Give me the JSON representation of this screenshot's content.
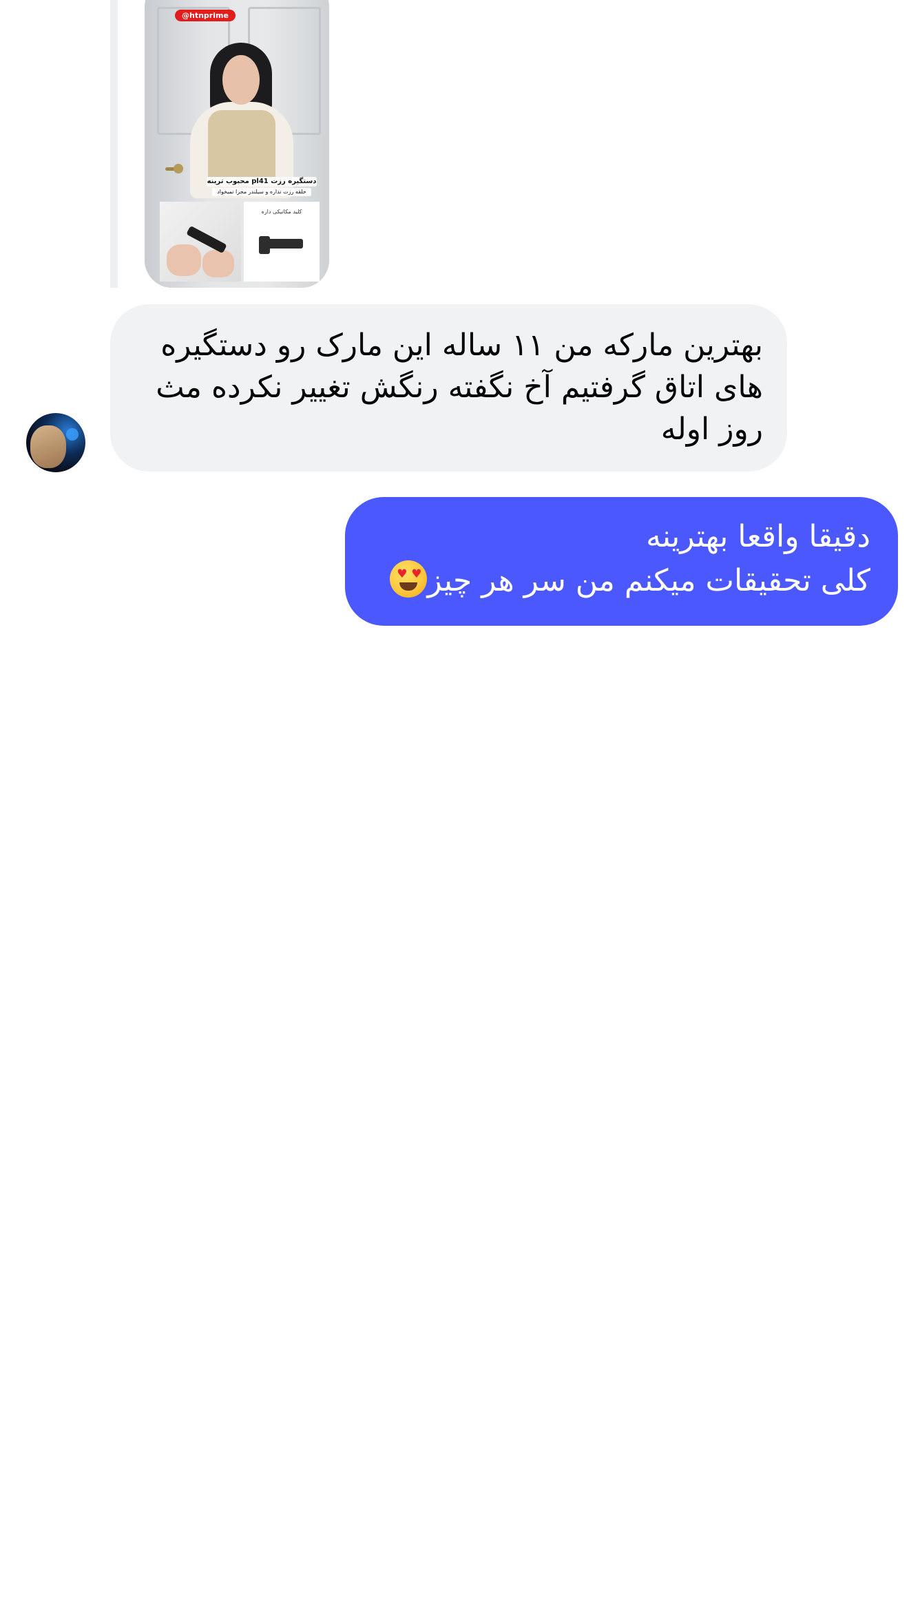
{
  "thread": {
    "shared_post": {
      "watermark": "@htnprime",
      "caption": "دستگیره رزت pl41 محبوب ترینه",
      "caption_sub": "حلقه رزت نداره و سیلندر مجزا نمیخواد",
      "inset_label": "کلید مکانیکی داره"
    },
    "incoming": {
      "lines": [
        "بهترین مارکه من ۱۱ ساله این مارک رو دستگیره",
        "های اتاق گرفتیم آخ نگفته رنگش تغییر نکرده مث",
        "روز اوله"
      ]
    },
    "outgoing": {
      "lines": [
        "دقیقا واقعا بهترینه",
        "کلی تحقیقات میکنم من سر هر چیز"
      ],
      "emoji": "smiling-face-with-heart-eyes"
    }
  },
  "colors": {
    "incoming_bubble": "#f1f2f4",
    "outgoing_bubble": "#4b58fd",
    "reply_bar": "#eeeff1",
    "watermark": "#e11d1d"
  }
}
